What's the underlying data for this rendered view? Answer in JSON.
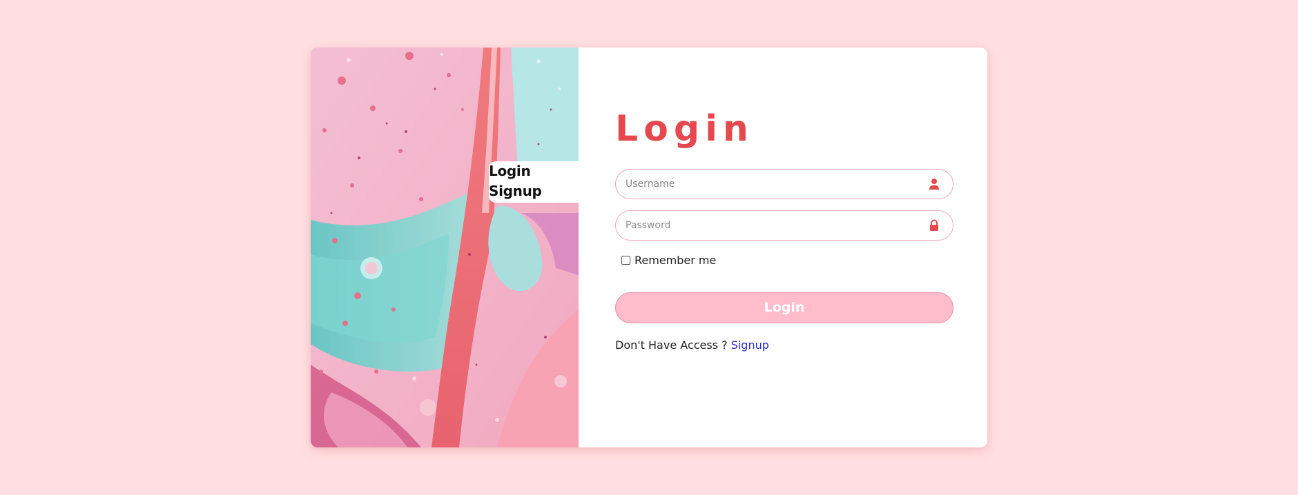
{
  "switcher": {
    "login_label": "Login",
    "signup_label": "Signup"
  },
  "form": {
    "title": "Login",
    "username_placeholder": "Username",
    "password_placeholder": "Password",
    "remember_label": "Remember me",
    "remember_checked": false,
    "submit_label": "Login",
    "access_prompt": "Don't Have Access ?",
    "signup_link": "Signup"
  },
  "icons": {
    "username": "user-icon",
    "password": "lock-icon"
  },
  "colors": {
    "page_background": "#ffdfe1",
    "accent": "#e5484d",
    "button_fill": "#ffbcca",
    "field_border": "#f4a9b8",
    "link": "#2a2ad6"
  }
}
